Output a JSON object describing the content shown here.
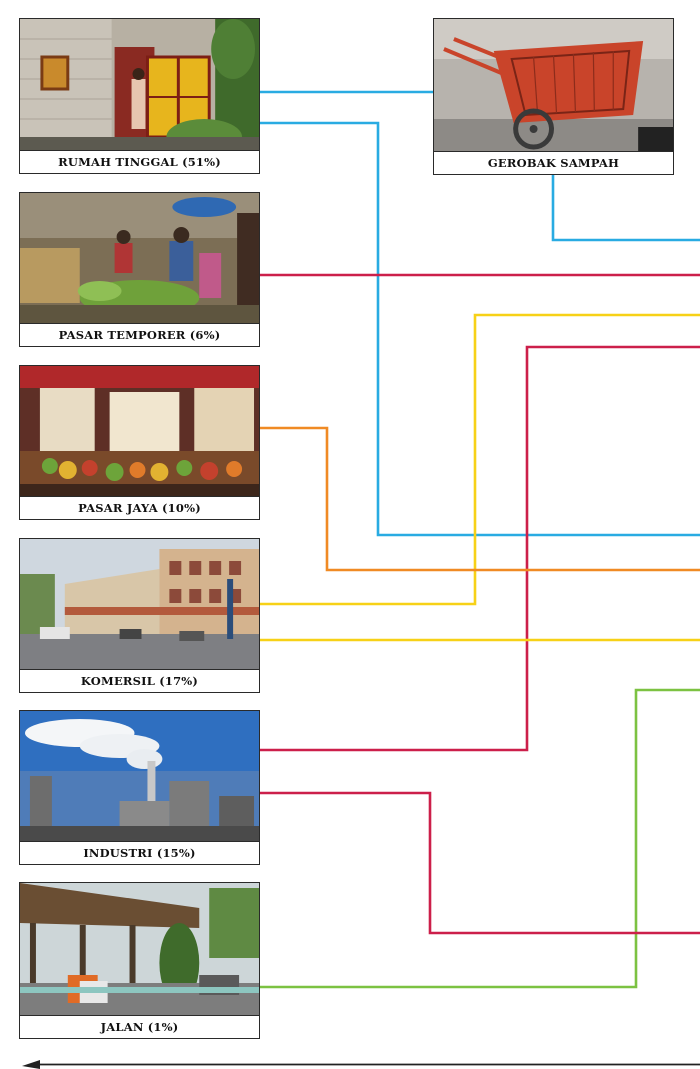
{
  "sources": [
    {
      "label": "RUMAH TINGGAL (51%)",
      "icon": "house-photo"
    },
    {
      "label": "PASAR TEMPORER (6%)",
      "icon": "temporary-market-photo"
    },
    {
      "label": "PASAR JAYA (10%)",
      "icon": "market-stall-photo"
    },
    {
      "label": "KOMERSIL (17%)",
      "icon": "commercial-street-photo"
    },
    {
      "label": "INDUSTRI (15%)",
      "icon": "factory-photo"
    },
    {
      "label": "JALAN (1%)",
      "icon": "street-photo"
    }
  ],
  "collector": {
    "label": "GEROBAK SAMPAH",
    "icon": "garbage-cart-photo"
  },
  "colors": {
    "blue": "#29abe2",
    "red": "#cc1f4a",
    "yellow": "#f7d117",
    "orange": "#f08a24",
    "green": "#7cc242",
    "border": "#2a2a2a"
  }
}
